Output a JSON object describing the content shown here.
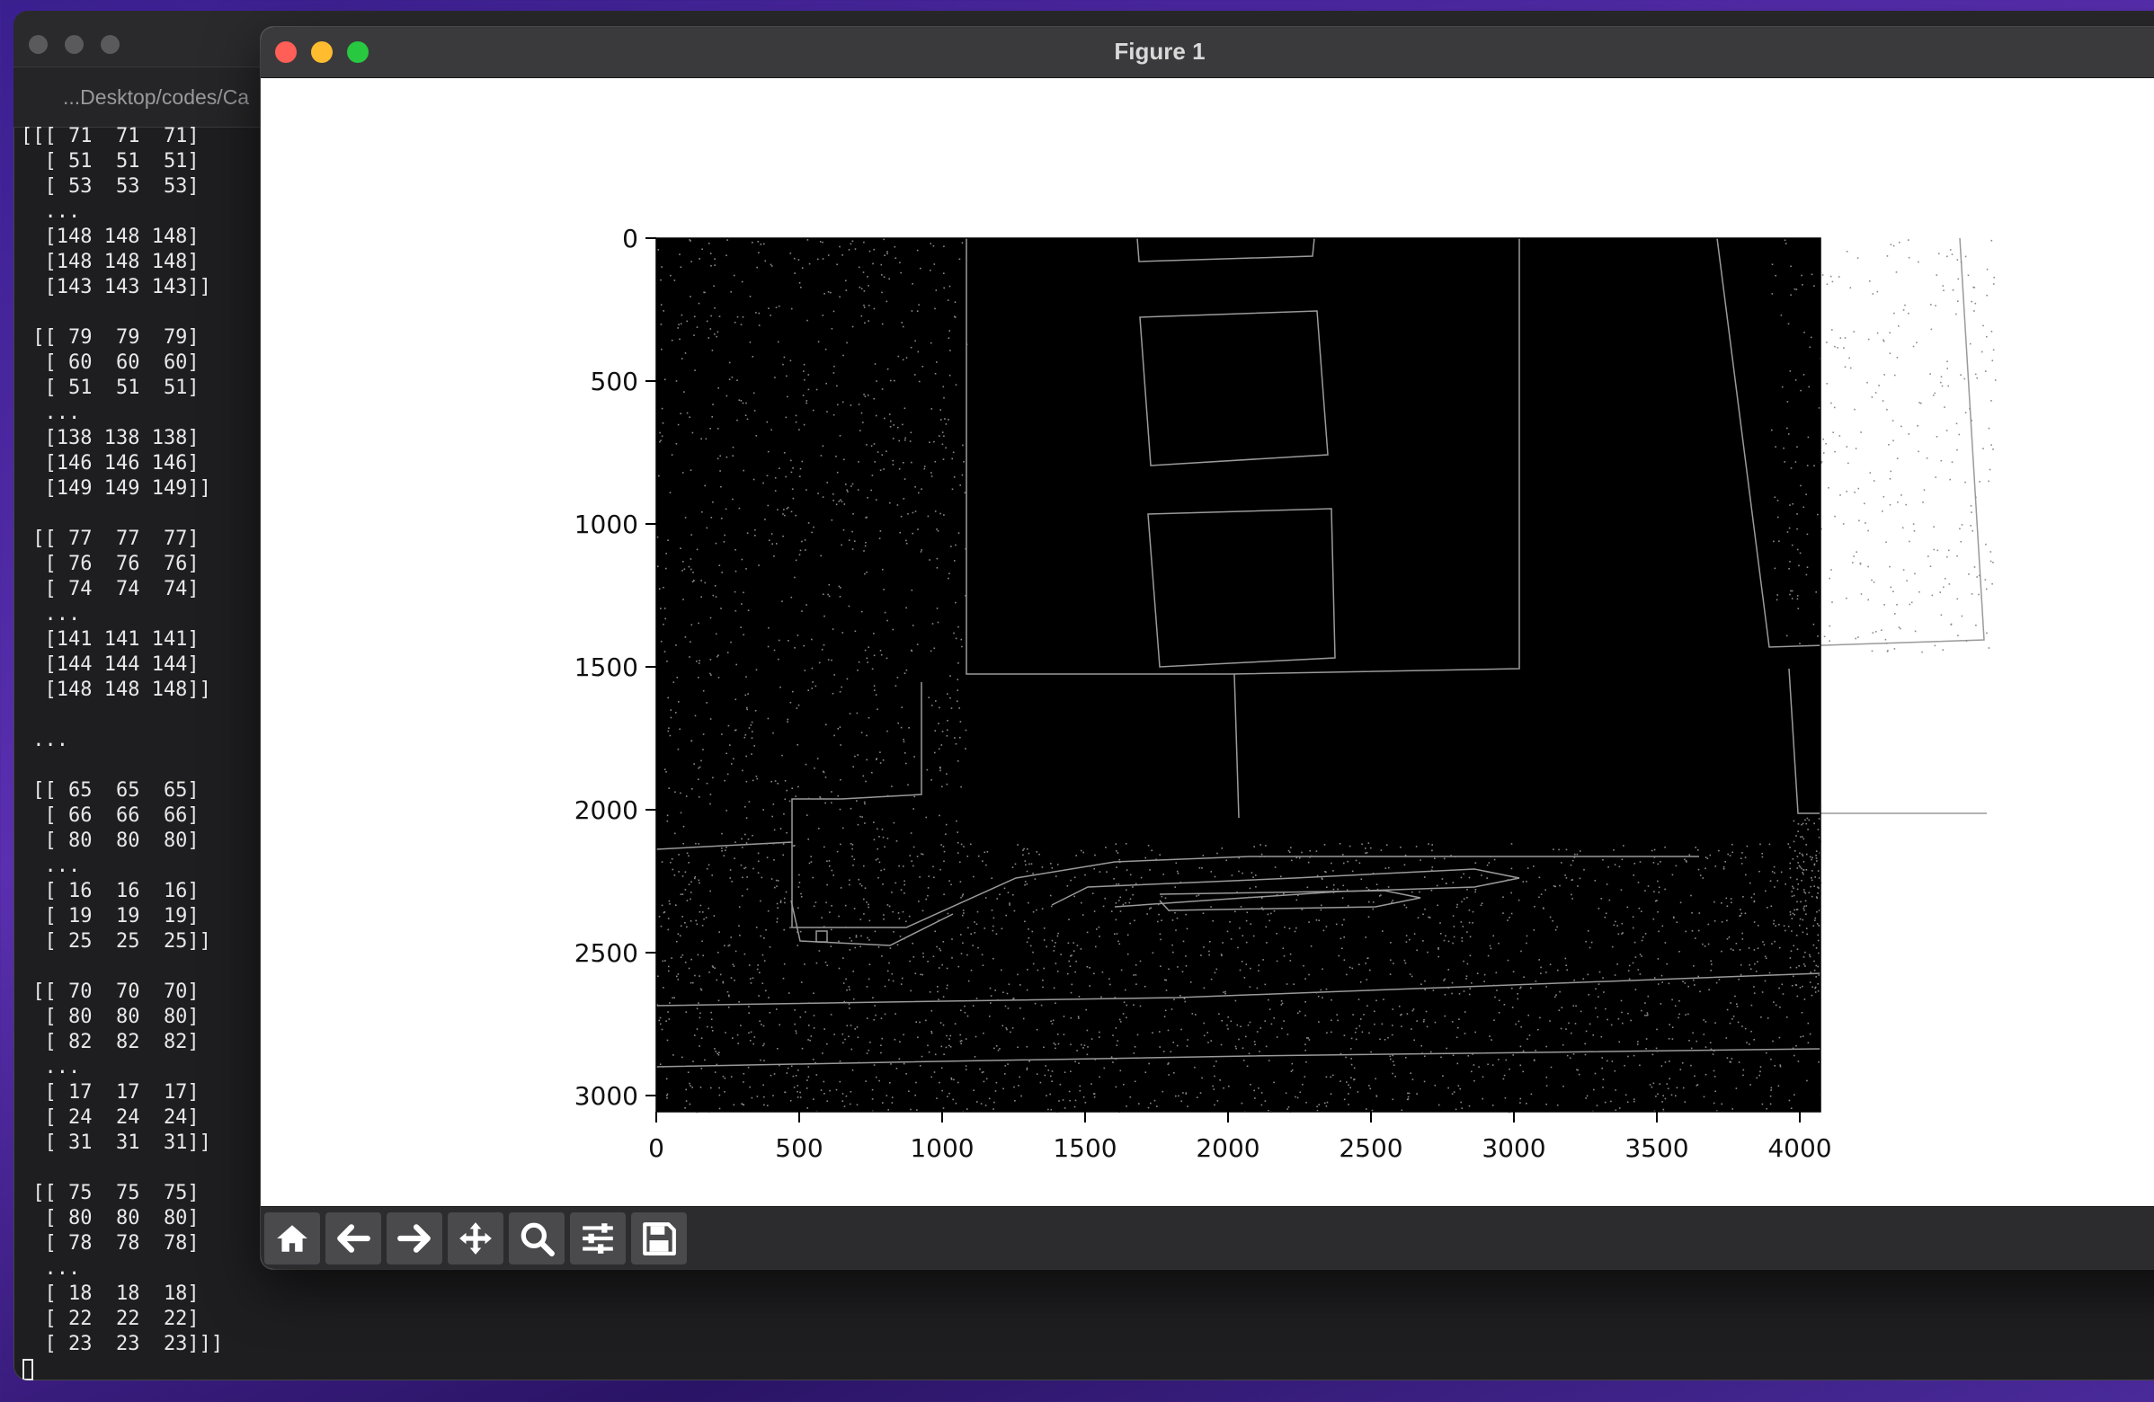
{
  "terminal": {
    "tab_title": "...Desktop/codes/Ca",
    "output_lines": [
      "[[[ 71  71  71]",
      "  [ 51  51  51]",
      "  [ 53  53  53]",
      "  ...",
      "  [148 148 148]",
      "  [148 148 148]",
      "  [143 143 143]]",
      "",
      " [[ 79  79  79]",
      "  [ 60  60  60]",
      "  [ 51  51  51]",
      "  ...",
      "  [138 138 138]",
      "  [146 146 146]",
      "  [149 149 149]]",
      "",
      " [[ 77  77  77]",
      "  [ 76  76  76]",
      "  [ 74  74  74]",
      "  ...",
      "  [141 141 141]",
      "  [144 144 144]",
      "  [148 148 148]]",
      "",
      " ...",
      "",
      " [[ 65  65  65]",
      "  [ 66  66  66]",
      "  [ 80  80  80]",
      "  ...",
      "  [ 16  16  16]",
      "  [ 19  19  19]",
      "  [ 25  25  25]]",
      "",
      " [[ 70  70  70]",
      "  [ 80  80  80]",
      "  [ 82  82  82]",
      "  ...",
      "  [ 17  17  17]",
      "  [ 24  24  24]",
      "  [ 31  31  31]]",
      "",
      " [[ 75  75  75]",
      "  [ 80  80  80]",
      "  [ 78  78  78]",
      "  ...",
      "  [ 18  18  18]",
      "  [ 22  22  22]",
      "  [ 23  23  23]]]"
    ]
  },
  "figure": {
    "title": "Figure 1",
    "toolbar": [
      {
        "name": "home-button",
        "icon": "home-icon"
      },
      {
        "name": "back-button",
        "icon": "arrow-left-icon"
      },
      {
        "name": "forward-button",
        "icon": "arrow-right-icon"
      },
      {
        "name": "pan-button",
        "icon": "move-icon"
      },
      {
        "name": "zoom-button",
        "icon": "magnifier-icon"
      },
      {
        "name": "configure-subplots-button",
        "icon": "sliders-icon"
      },
      {
        "name": "save-button",
        "icon": "floppy-disk-icon"
      }
    ],
    "plot": {
      "type": "image",
      "content": "edge-detected image (white edges on black)",
      "x_ticks": [
        "0",
        "500",
        "1000",
        "1500",
        "2000",
        "2500",
        "3000",
        "3500",
        "4000"
      ],
      "y_ticks": [
        "0",
        "500",
        "1000",
        "1500",
        "2000",
        "2500",
        "3000"
      ],
      "xlim": [
        0,
        4032
      ],
      "ylim": [
        3024,
        0
      ]
    }
  },
  "colors": {
    "close": "#ff5f57",
    "minimize": "#febc2e",
    "maximize": "#28c840",
    "terminal_bg": "#1e1e20",
    "image_bg": "#000000"
  }
}
